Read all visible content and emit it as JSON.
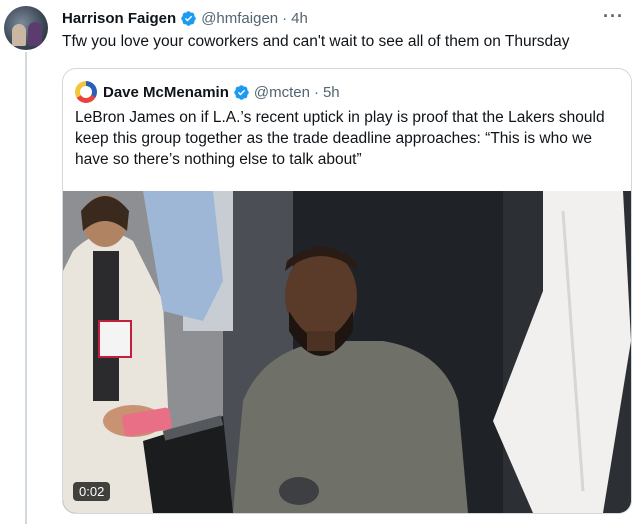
{
  "tweet": {
    "author_name": "Harrison Faigen",
    "author_handle": "@hmfaigen",
    "separator": "·",
    "time": "4h",
    "text": "Tfw you love your coworkers and can't wait to see all of them on Thursday",
    "more_icon": "more-icon"
  },
  "quoted": {
    "author_name": "Dave McMenamin",
    "author_handle": "@mcten",
    "separator": "·",
    "time": "5h",
    "text": "LeBron James on if L.A.’s recent uptick in play is proof that the Lakers should keep this group together as the trade deadline approaches: “This is who we have so there’s nothing else to talk about”",
    "video_duration": "0:02"
  },
  "colors": {
    "verified": "#1d9bf0",
    "muted": "#536471",
    "border": "#cfd9de"
  }
}
